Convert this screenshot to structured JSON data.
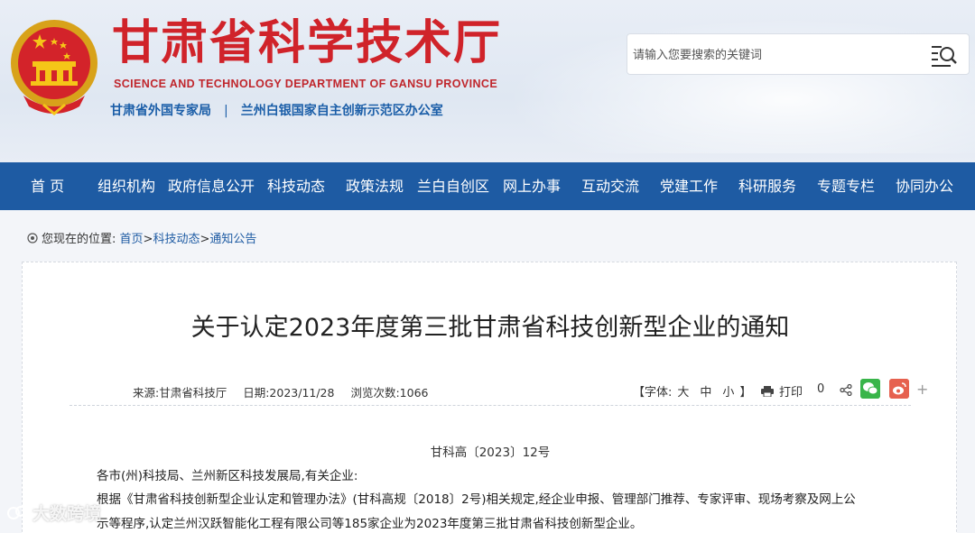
{
  "header": {
    "title_cn": "甘肃省科学技术厅",
    "title_en": "SCIENCE AND TECHNOLOGY DEPARTMENT OF GANSU PROVINCE",
    "sub_link_1": "甘肃省外国专家局",
    "separator": "|",
    "sub_link_2": "兰州白银国家自主创新示范区办公室",
    "search_placeholder": "请输入您要搜索的关键词",
    "brand_color": "#d0232a"
  },
  "nav": {
    "items": [
      "首 页",
      "组织机构",
      "政府信息公开",
      "科技动态",
      "政策法规",
      "兰白自创区",
      "网上办事",
      "互动交流",
      "党建工作",
      "科研服务",
      "专题专栏",
      "协同办公"
    ],
    "background_color": "#1e5ba3"
  },
  "breadcrumb": {
    "prefix": "您现在的位置:",
    "home": "首页",
    "arrow": ">",
    "level1": "科技动态",
    "level2": "通知公告"
  },
  "article": {
    "title": "关于认定2023年度第三批甘肃省科技创新型企业的通知",
    "source": "来源:甘肃省科技厅",
    "date": "日期:2023/11/28",
    "views": "浏览次数:1066",
    "font_size_label": "【字体:",
    "font_large": "大",
    "font_medium": "中",
    "font_small": "小",
    "font_size_end": "】",
    "print_label": "打印",
    "share_count": "0",
    "plus": "+",
    "doc_number": "甘科高〔2023〕12号",
    "salutation": "各市(州)科技局、兰州新区科技发展局,有关企业:",
    "body_line_1": "根据《甘肃省科技创新型企业认定和管理办法》(甘科高规〔2018〕2号)相关规定,经企业申报、管理部门推荐、专家评审、现场考察及网上公",
    "body_line_2": "示等程序,认定兰州汉跃智能化工程有限公司等185家企业为2023年度第三批甘肃省科技创新型企业。"
  },
  "watermark": "大数跨境",
  "icons": {
    "emblem": "national-emblem-icon",
    "search": "search-icon",
    "location": "location-icon",
    "print": "printer-icon",
    "share": "share-icon",
    "wechat": "wechat-icon",
    "weibo": "weibo-icon"
  }
}
